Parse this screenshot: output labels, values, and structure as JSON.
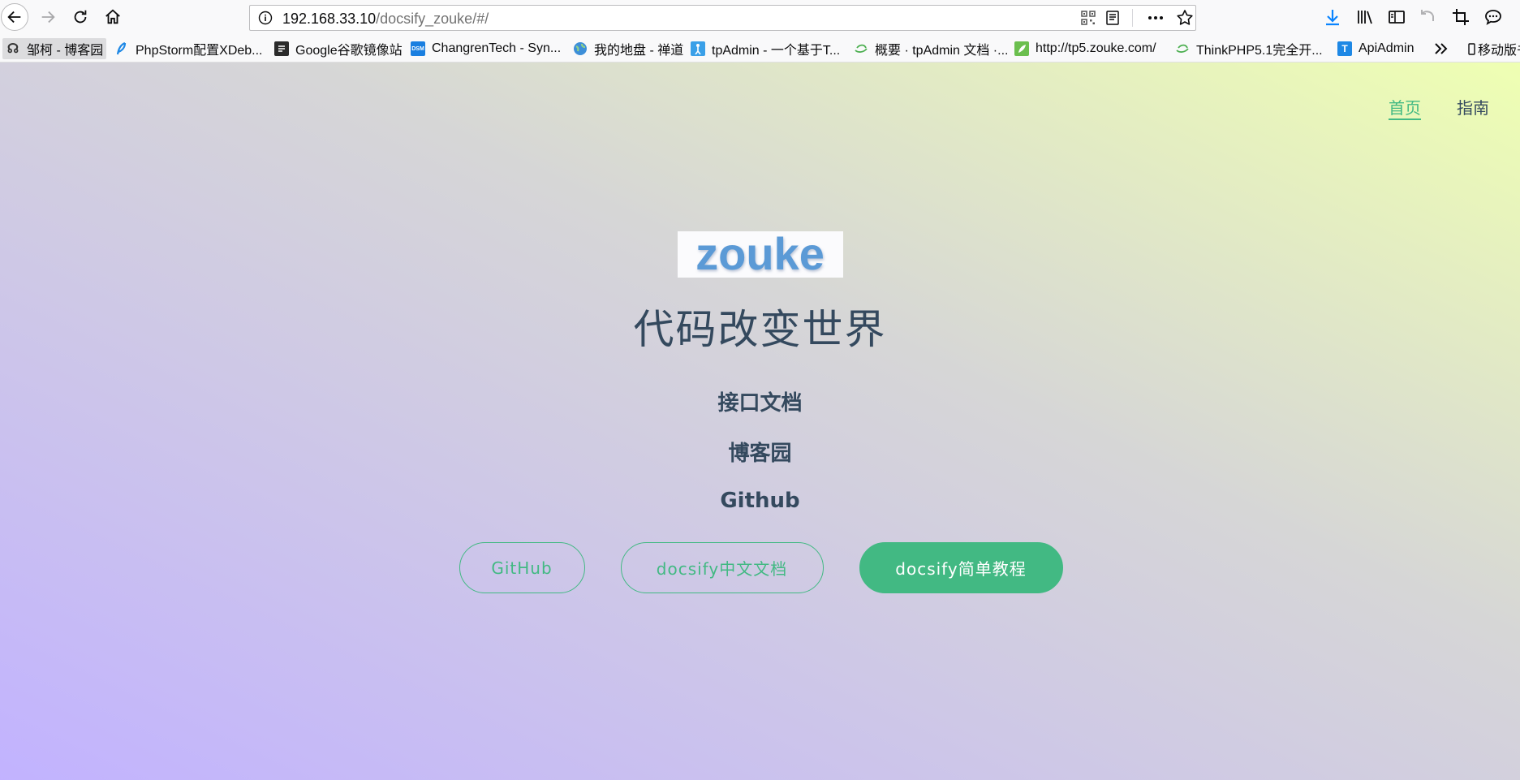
{
  "browser": {
    "url_host": "192.168.33.10",
    "url_path": "/docsify_zouke/#/",
    "bookmarks": [
      {
        "label": "邹柯 - 博客园",
        "icon": "cnblogs-icon"
      },
      {
        "label": "PhpStorm配置XDeb...",
        "icon": "feather-icon"
      },
      {
        "label": "Google谷歌镜像站",
        "icon": "doc-icon"
      },
      {
        "label": "ChangrenTech - Syn...",
        "icon": "dsm-icon"
      },
      {
        "label": "我的地盘 - 禅道",
        "icon": "globe-icon"
      },
      {
        "label": "tpAdmin - 一个基于T...",
        "icon": "person-icon"
      },
      {
        "label": "概要 · tpAdmin 文档 ·...",
        "icon": "gitbook-icon"
      },
      {
        "label": "http://tp5.zouke.com/",
        "icon": "leaf-icon"
      },
      {
        "label": "ThinkPHP5.1完全开...",
        "icon": "gitbook-icon"
      },
      {
        "label": "ApiAdmin",
        "icon": "t-icon"
      },
      {
        "label": "移动版书签",
        "icon": "mobile-icon"
      }
    ],
    "dsm_icon_text": "DSM",
    "t_icon_text": "T"
  },
  "nav": {
    "home": "首页",
    "guide": "指南"
  },
  "cover": {
    "logo_text": "zouke",
    "slogan": "代码改变世界",
    "links": [
      "接口文档",
      "博客园",
      "Github"
    ],
    "buttons": [
      "GitHub",
      "docsify中文文档",
      "docsify简单教程"
    ]
  },
  "colors": {
    "accent": "#42b983",
    "text": "#34495e",
    "logo": "#5b9ad6"
  }
}
